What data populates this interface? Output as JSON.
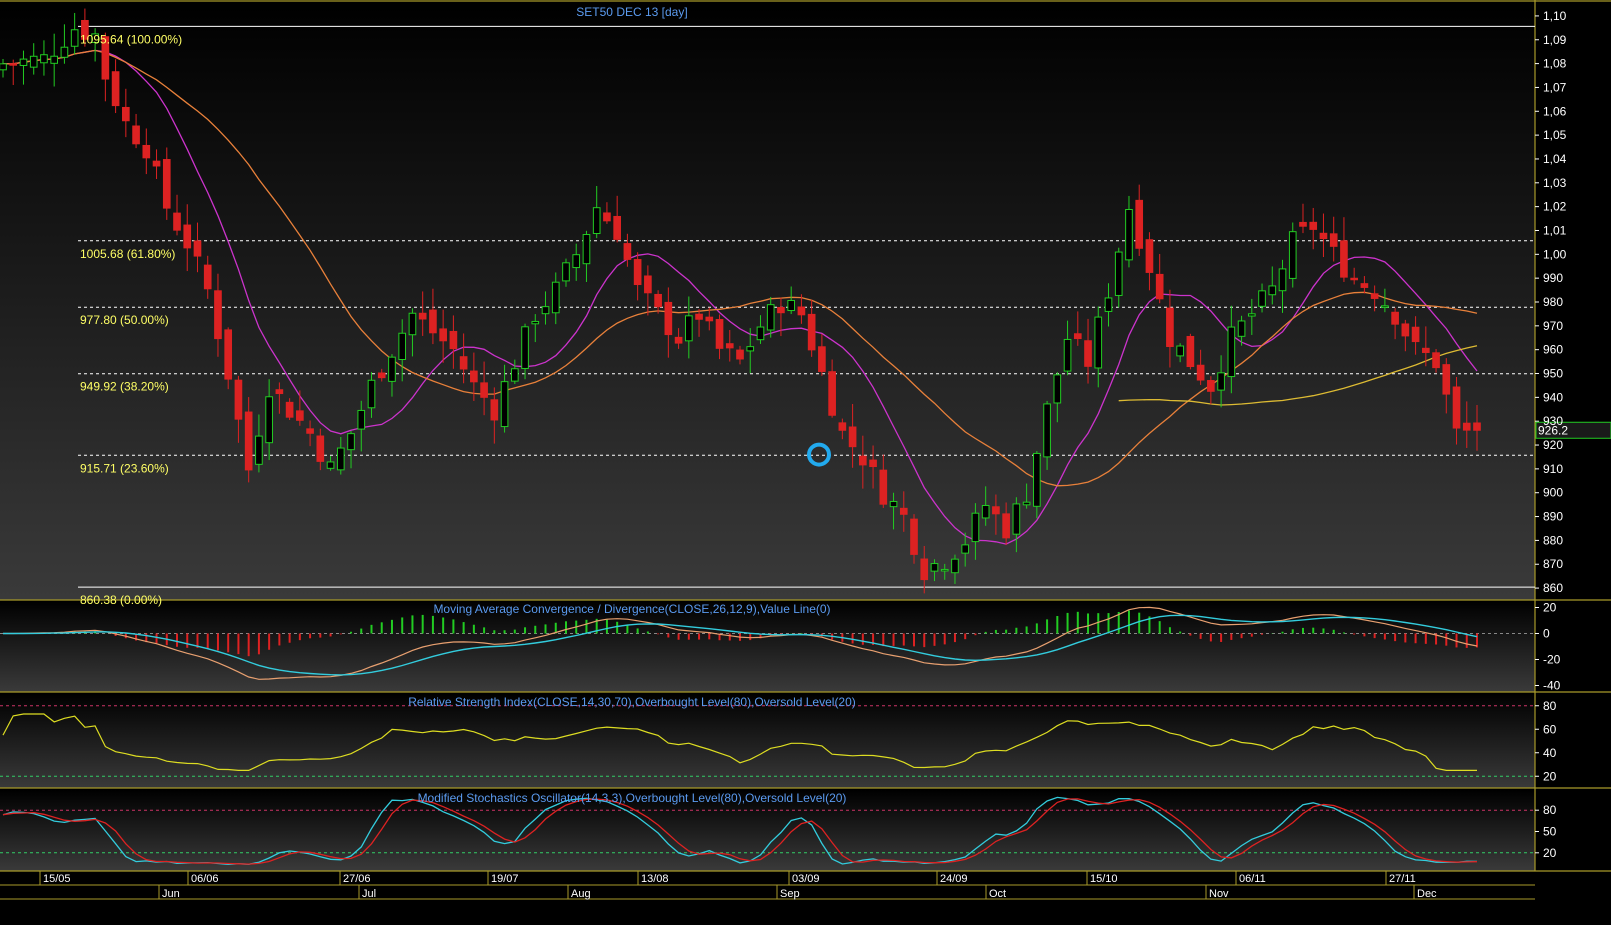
{
  "chart_data": [
    {
      "type": "candlestick",
      "title": "SET50 DEC 13   [day]",
      "ylim": [
        855,
        1105
      ],
      "y_ticks": [
        860,
        870,
        880,
        890,
        900,
        910,
        920,
        930,
        940,
        950,
        960,
        970,
        980,
        990,
        1000,
        1010,
        1020,
        1030,
        1040,
        1050,
        1060,
        1070,
        1080,
        1090,
        1100
      ],
      "y_tick_labels": [
        "860",
        "870",
        "880",
        "890",
        "900",
        "910",
        "920",
        "930",
        "940",
        "950",
        "960",
        "970",
        "980",
        "990",
        "1,00",
        "1,01",
        "1,02",
        "1,03",
        "1,04",
        "1,05",
        "1,06",
        "1,07",
        "1,08",
        "1,09",
        "1,10"
      ],
      "last_price_label": "926.2",
      "x_labels_top": [
        "15/05",
        "06/06",
        "27/06",
        "19/07",
        "13/08",
        "03/09",
        "24/09",
        "15/10",
        "06/11",
        "27/11"
      ],
      "x_labels_bottom": [
        "Jun",
        "Jul",
        "Aug",
        "Sep",
        "Oct",
        "Nov",
        "Dec"
      ],
      "fib_levels": [
        {
          "label": "1095.64 (100.00%)",
          "value": 1095.64
        },
        {
          "label": "1005.68 (61.80%)",
          "value": 1005.68
        },
        {
          "label": "977.80 (50.00%)",
          "value": 977.8
        },
        {
          "label": "949.92 (38.20%)",
          "value": 949.92
        },
        {
          "label": "915.71 (23.60%)",
          "value": 915.71
        },
        {
          "label": "860.38 (0.00%)",
          "value": 860.38
        }
      ],
      "highlight": {
        "description": "circle marker",
        "value": 916
      },
      "colors": {
        "up": "#22cc22",
        "down": "#dd2222",
        "ma_short": "#cc33cc",
        "ma_long": "#e8803a",
        "ma_extra": "#ddbb33",
        "fib": "#ffff66",
        "title": "#5b9bf0"
      }
    },
    {
      "type": "line",
      "title": "Moving Average Convergence / Divergence(CLOSE,26,12,9),Value Line(0)",
      "ylim": [
        -45,
        25
      ],
      "y_ticks": [
        20,
        0,
        -20,
        -40
      ]
    },
    {
      "type": "line",
      "title": "Relative Strength Index(CLOSE,14,30,70),Overbought Level(80),Oversold Level(20)",
      "ylim": [
        10,
        90
      ],
      "y_ticks": [
        80,
        60,
        40,
        20
      ],
      "levels": [
        80,
        20
      ]
    },
    {
      "type": "line",
      "title": "Modified Stochastics Oscillator(14,3,3),Overbought Level(80),Oversold Level(20)",
      "ylim": [
        0,
        100
      ],
      "y_ticks": [
        80,
        50,
        20
      ],
      "levels": [
        80,
        20
      ]
    }
  ]
}
